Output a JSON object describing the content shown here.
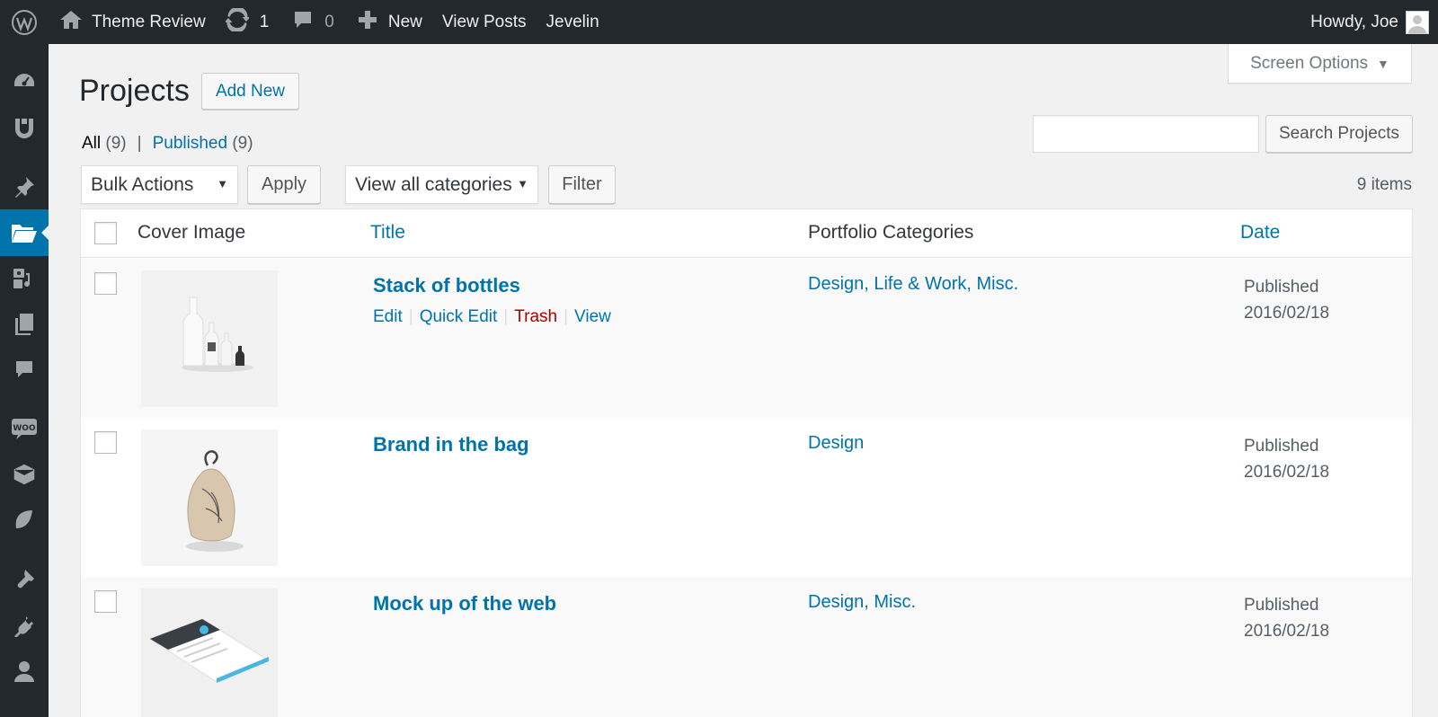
{
  "admin_bar": {
    "site_name": "Theme Review",
    "updates_count": "1",
    "comments_count": "0",
    "new_label": "New",
    "view_posts_label": "View Posts",
    "theme_name": "Jevelin",
    "howdy": "Howdy, Joe"
  },
  "menu": {
    "icons": [
      "dashboard-icon",
      "unyson-icon",
      "posts-pin-icon",
      "projects-folder-icon",
      "media-icon",
      "pages-icon",
      "comments-icon",
      "woocommerce-icon",
      "products-box-icon",
      "leaf-icon",
      "appearance-brush-icon",
      "plugins-icon",
      "users-icon"
    ],
    "current": "projects-folder-icon"
  },
  "page": {
    "title": "Projects",
    "add_new": "Add New",
    "screen_options": "Screen Options"
  },
  "views": {
    "all_label": "All",
    "all_count": "(9)",
    "separator": "|",
    "published_label": "Published",
    "published_count": "(9)"
  },
  "search": {
    "value": "",
    "button": "Search Projects"
  },
  "tablenav": {
    "bulk_actions": "Bulk Actions",
    "apply": "Apply",
    "categories": "View all categories",
    "filter": "Filter",
    "items": "9 items"
  },
  "columns": {
    "cover": "Cover Image",
    "title": "Title",
    "categories": "Portfolio Categories",
    "date": "Date"
  },
  "rows": [
    {
      "title": "Stack of bottles",
      "actions": {
        "edit": "Edit",
        "quick_edit": "Quick Edit",
        "trash": "Trash",
        "view": "View"
      },
      "categories": "Design, Life & Work, Misc.",
      "status": "Published",
      "date": "2016/02/18"
    },
    {
      "title": "Brand in the bag",
      "categories": "Design",
      "status": "Published",
      "date": "2016/02/18"
    },
    {
      "title": "Mock up of the web",
      "categories": "Design, Misc.",
      "status": "Published",
      "date": "2016/02/18"
    }
  ],
  "colors": {
    "admin_bar": "#23282d",
    "link": "#0073aa",
    "trash": "#aa0000",
    "current_menu": "#0073aa"
  }
}
